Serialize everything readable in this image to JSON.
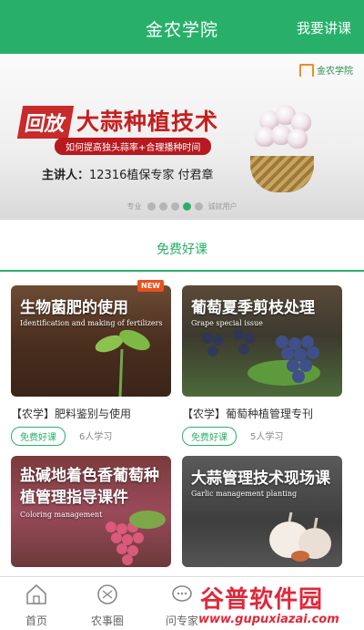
{
  "header": {
    "title": "金农学院",
    "action_label": "我要讲课"
  },
  "banner": {
    "logo_text": "金农学院",
    "tag": "回放",
    "headline": "大蒜种植技术",
    "subtitle": "如何提高独头蒜率+合理播种时间",
    "lecturer_label": "主讲人：",
    "lecturer": "12316植保专家 付君章",
    "dots_left": "专业",
    "dots_right": "诚就用户",
    "slide_count": 5,
    "active_slide": 4
  },
  "section": {
    "title": "免费好课"
  },
  "courses": [
    {
      "title": "生物菌肥的使用",
      "subtitle": "Identification and making of fertilizers",
      "name": "【农学】肥料鉴别与使用",
      "tag": "免费好课",
      "count": "6人学习",
      "badge": "NEW"
    },
    {
      "title": "葡萄夏季剪枝处理",
      "subtitle": "Grape special issue",
      "name": "【农学】葡萄种植管理专刊",
      "tag": "免费好课",
      "count": "5人学习"
    },
    {
      "title": "盐碱地着色香葡萄种植管理指导课件",
      "subtitle": "Coloring management",
      "name": "",
      "tag": "",
      "count": ""
    },
    {
      "title": "大蒜管理技术现场课",
      "subtitle": "Garlic management planting",
      "name": "",
      "tag": "",
      "count": ""
    }
  ],
  "tabbar": [
    {
      "label": "首页",
      "icon": "home-icon"
    },
    {
      "label": "农事圈",
      "icon": "circle-icon"
    },
    {
      "label": "问专家",
      "icon": "chat-icon"
    }
  ],
  "watermark": {
    "title": "谷普软件园",
    "url": "www.gupuxiazai.com"
  }
}
